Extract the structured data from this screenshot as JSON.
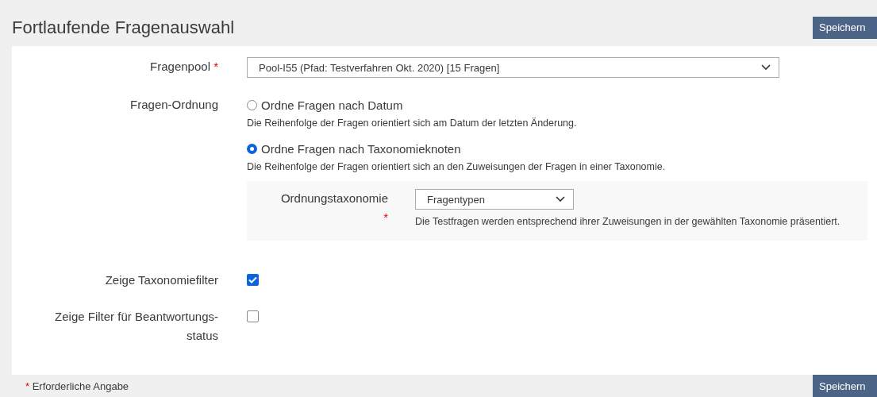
{
  "header": {
    "title": "Fortlaufende Fragenauswahl",
    "save_button": "Speichern"
  },
  "fields": [
    {
      "kind": "select",
      "label": "Fragenpool",
      "required": true,
      "value": "Pool-I55 (Pfad: Testverfahren Okt. 2020) [15 Fragen]"
    },
    {
      "kind": "radio",
      "label": "Fragen-Ordnung",
      "required": false,
      "options": [
        {
          "label": "Ordne Fragen nach Datum",
          "selected": false,
          "description": "Die Reihenfolge der Fragen orientiert sich am Datum der letzten Änderung."
        },
        {
          "label": "Ordne Fragen nach Taxonomieknoten",
          "selected": true,
          "description": "Die Reihenfolge der Fragen orientiert sich an den Zuweisungen der Fragen in einer Taxonomie.",
          "subfield": {
            "label": "Ordnungstaxonomie",
            "required": true,
            "value": "Fragentypen",
            "description": "Die Testfragen werden entsprechend ihrer Zuweisungen in der gewählten Taxonomie präsentiert."
          }
        }
      ]
    },
    {
      "kind": "checkbox",
      "label": "Zeige Taxonomiefilter",
      "required": false,
      "checked": true
    },
    {
      "kind": "checkbox",
      "label": "Zeige Filter für Beantwortungs-status",
      "required": false,
      "checked": false
    }
  ],
  "footer": {
    "required_mark": "*",
    "required_note": "Erforderliche Angabe",
    "save_button": "Speichern"
  }
}
